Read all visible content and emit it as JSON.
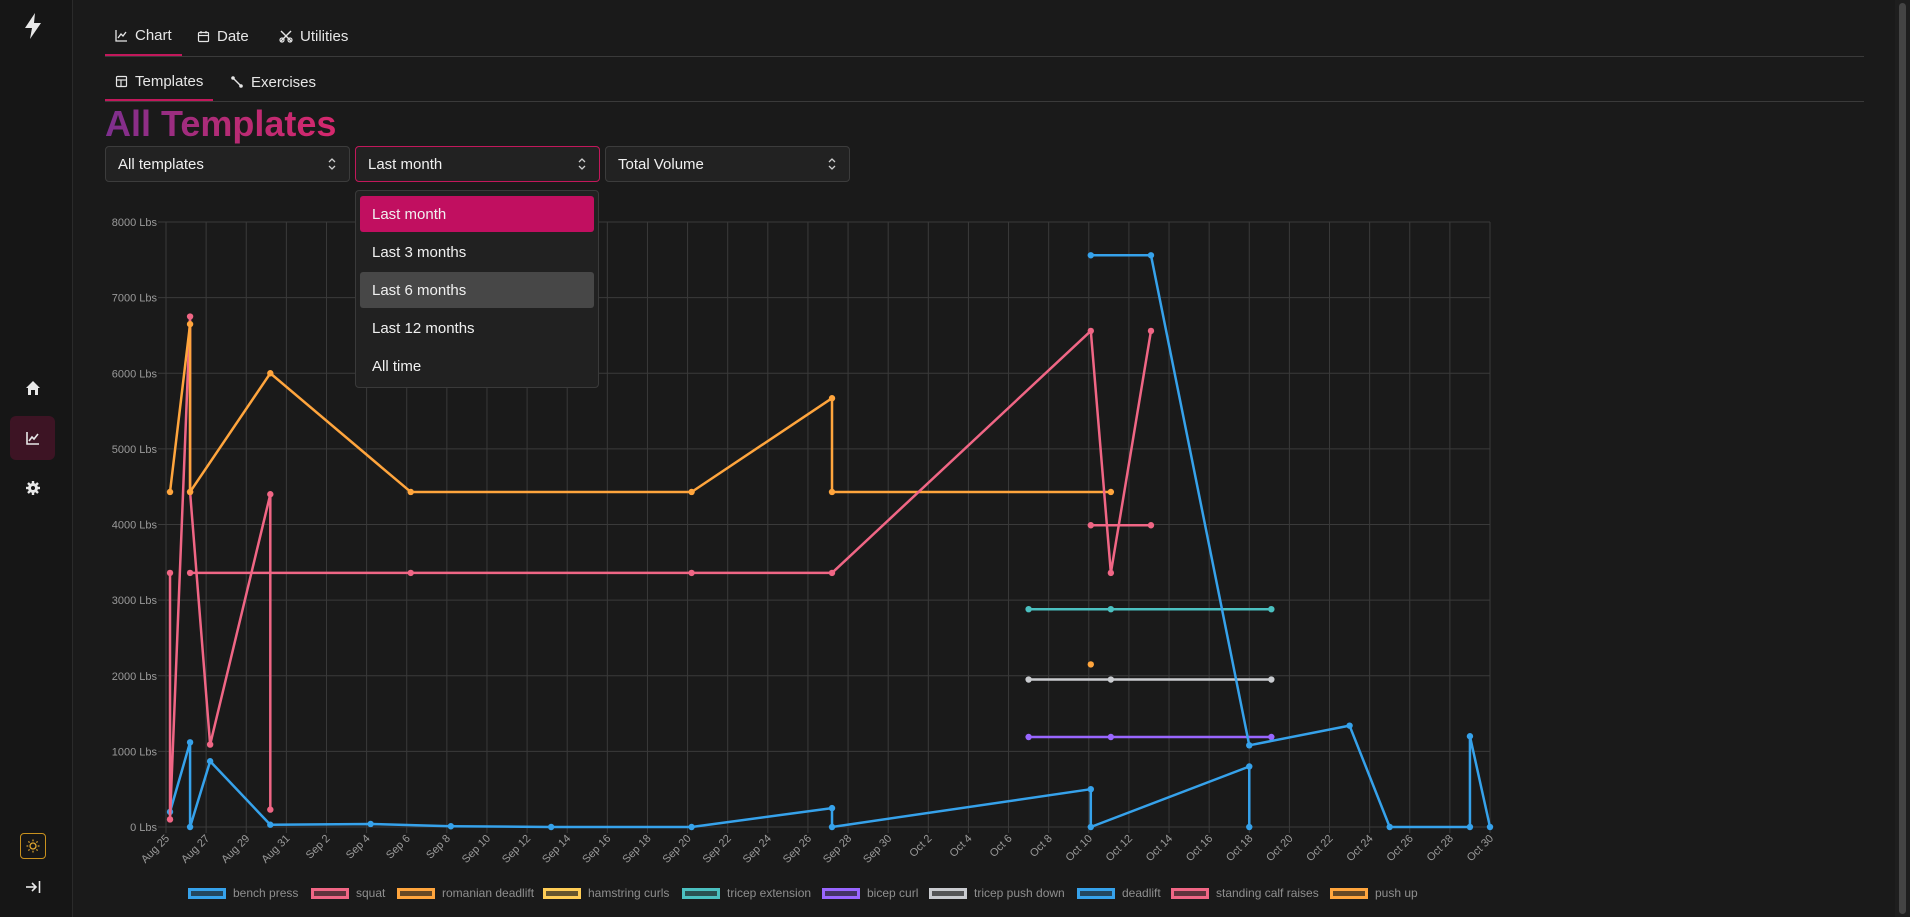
{
  "tabs": [
    {
      "label": "Chart",
      "icon": "chart-line-icon",
      "active": true
    },
    {
      "label": "Date",
      "icon": "calendar-icon",
      "active": false
    },
    {
      "label": "Utilities",
      "icon": "tools-icon",
      "active": false
    }
  ],
  "subtabs": [
    {
      "label": "Templates",
      "icon": "template-icon",
      "active": true
    },
    {
      "label": "Exercises",
      "icon": "exercise-icon",
      "active": false
    }
  ],
  "page_title": "All Templates",
  "filters": {
    "template": "All templates",
    "period": "Last month",
    "metric": "Total Volume"
  },
  "period_options": [
    "Last month",
    "Last 3 months",
    "Last 6 months",
    "Last 12 months",
    "All time"
  ],
  "period_selected": "Last month",
  "period_hovered": "Last 6 months",
  "sidebar": {
    "logo_icon": "lightning-bolt-icon",
    "items": [
      {
        "name": "home",
        "icon": "home-icon"
      },
      {
        "name": "chart",
        "icon": "chart-icon",
        "active": true
      },
      {
        "name": "settings",
        "icon": "gear-icon"
      }
    ],
    "theme_icon": "sun-icon",
    "logout_icon": "logout-icon"
  },
  "chart_data": {
    "type": "line",
    "title": "",
    "xlabel": "",
    "ylabel": "",
    "ylim": [
      0,
      8000
    ],
    "y_ticks": [
      0,
      1000,
      2000,
      3000,
      4000,
      5000,
      6000,
      7000,
      8000
    ],
    "y_unit": "Lbs",
    "x_domain_days": [
      0,
      66
    ],
    "x_ticks": [
      "Aug 25",
      "Aug 27",
      "Aug 29",
      "Aug 31",
      "Sep 2",
      "Sep 4",
      "Sep 6",
      "Sep 8",
      "Sep 10",
      "Sep 12",
      "Sep 14",
      "Sep 16",
      "Sep 18",
      "Sep 20",
      "Sep 22",
      "Sep 24",
      "Sep 26",
      "Sep 28",
      "Sep 30",
      "Oct 2",
      "Oct 4",
      "Oct 6",
      "Oct 8",
      "Oct 10",
      "Oct 12",
      "Oct 14",
      "Oct 16",
      "Oct 18",
      "Oct 20",
      "Oct 22",
      "Oct 24",
      "Oct 26",
      "Oct 28",
      "Oct 30"
    ],
    "grid": true,
    "legend_position": "bottom",
    "series": [
      {
        "name": "bench press",
        "color": "#36a2eb",
        "points": [
          [
            0.2,
            200
          ],
          [
            1.2,
            1120
          ],
          [
            1.2,
            0
          ],
          [
            2.2,
            870
          ],
          [
            5.2,
            30
          ],
          [
            10.2,
            40
          ],
          [
            14.2,
            10
          ],
          [
            19.2,
            0
          ],
          [
            26.2,
            0
          ],
          [
            33.2,
            250
          ],
          [
            33.2,
            0
          ],
          [
            46.1,
            500
          ],
          [
            46.1,
            0
          ],
          [
            54,
            800
          ],
          [
            54,
            0
          ]
        ]
      },
      {
        "name": "squat",
        "color": "#f06685",
        "points": [
          [
            0.2,
            3360
          ],
          [
            0.2,
            100
          ],
          [
            1.2,
            6750
          ],
          [
            1.2,
            4430
          ],
          [
            2.2,
            1090
          ],
          [
            5.2,
            4400
          ],
          [
            5.2,
            230
          ]
        ]
      },
      {
        "name": "romanian deadlift",
        "color": "#ffa53d",
        "points": [
          [
            0.2,
            4430
          ],
          [
            1.2,
            6650
          ],
          [
            1.2,
            4430
          ],
          [
            5.2,
            6000
          ],
          [
            12.2,
            4430
          ],
          [
            26.2,
            4430
          ],
          [
            33.2,
            5670
          ],
          [
            33.2,
            4430
          ],
          [
            47.1,
            4430
          ]
        ]
      },
      {
        "name": "hamstring curls",
        "color": "#ffcd56",
        "points": []
      },
      {
        "name": "tricep extension",
        "color": "#4bc0c0",
        "points": [
          [
            43,
            2880
          ],
          [
            47.1,
            2880
          ],
          [
            55.1,
            2880
          ]
        ]
      },
      {
        "name": "bicep curl",
        "color": "#9966ff",
        "points": [
          [
            43,
            1190
          ],
          [
            47.1,
            1190
          ],
          [
            55.1,
            1190
          ]
        ]
      },
      {
        "name": "tricep push down",
        "color": "#c9cbcf",
        "points": [
          [
            43,
            1950
          ],
          [
            47.1,
            1950
          ],
          [
            55.1,
            1950
          ]
        ]
      },
      {
        "name": "deadlift",
        "color": "#36a2eb",
        "points": [
          [
            46.1,
            7560
          ],
          [
            49.1,
            7560
          ],
          [
            54,
            1080
          ],
          [
            59,
            1340
          ],
          [
            61,
            0
          ],
          [
            65,
            0
          ],
          [
            65,
            1200
          ],
          [
            66,
            0
          ]
        ]
      },
      {
        "name": "standing calf raises",
        "color": "#f06685",
        "points": [
          [
            1.2,
            3360
          ],
          [
            12.2,
            3360
          ],
          [
            26.2,
            3360
          ],
          [
            33.2,
            3360
          ],
          [
            46.1,
            6560
          ],
          [
            47.1,
            3360
          ],
          [
            49.1,
            6560
          ]
        ]
      },
      {
        "name": "push up",
        "color": "#ffa53d",
        "points": [
          [
            46.1,
            2150
          ]
        ]
      },
      {
        "name": "standing calf raises (Oct 10)",
        "color": "#f06685",
        "points": [
          [
            46.1,
            3990
          ],
          [
            49.1,
            3990
          ]
        ],
        "hidden_name": true
      }
    ]
  }
}
